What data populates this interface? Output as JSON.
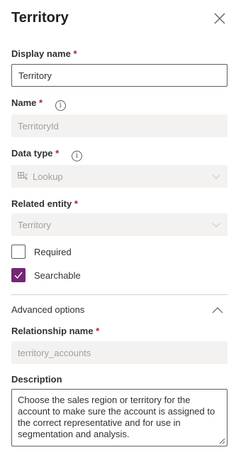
{
  "panel": {
    "title": "Territory",
    "close_icon": "close-icon"
  },
  "fields": {
    "display_name": {
      "label": "Display name",
      "required_mark": "*",
      "value": "Territory"
    },
    "name": {
      "label": "Name",
      "required_mark": "*",
      "value": "TerritoryId",
      "info_icon": "info-icon"
    },
    "data_type": {
      "label": "Data type",
      "required_mark": "*",
      "value": "Lookup",
      "icon": "lookup-icon",
      "info_icon": "info-icon"
    },
    "related_entity": {
      "label": "Related entity",
      "required_mark": "*",
      "value": "Territory"
    },
    "required": {
      "label": "Required",
      "checked": false
    },
    "searchable": {
      "label": "Searchable",
      "checked": true
    },
    "advanced_options": {
      "label": "Advanced options",
      "expanded": true
    },
    "relationship_name": {
      "label": "Relationship name",
      "required_mark": "*",
      "value": "territory_accounts"
    },
    "description": {
      "label": "Description",
      "value": "Choose the sales region or territory for the account to make sure the account is assigned to the correct representative and for use in segmentation and analysis."
    }
  },
  "colors": {
    "accent": "#742774",
    "required": "#a4262c",
    "disabled_bg": "#f3f2f1",
    "disabled_text": "#a19f9d"
  }
}
